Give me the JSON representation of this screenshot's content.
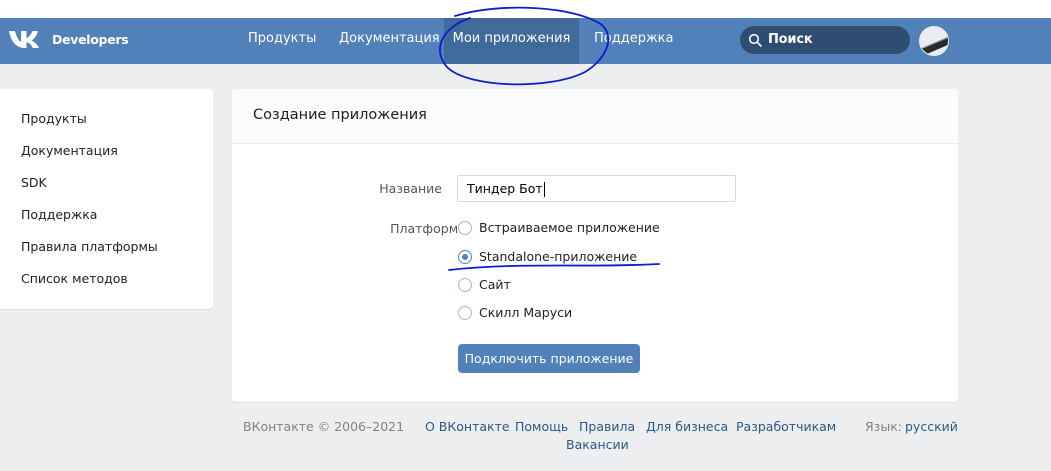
{
  "header": {
    "brand": "Developers",
    "logo_icon": "vk-logo-icon",
    "nav": [
      {
        "label": "Продукты",
        "active": false
      },
      {
        "label": "Документация",
        "active": false
      },
      {
        "label": "Мои приложения",
        "active": true
      },
      {
        "label": "Поддержка",
        "active": false
      }
    ],
    "search": {
      "label": "Поиск",
      "icon": "search-icon"
    },
    "avatar_icon": "avatar-icon"
  },
  "sidebar": {
    "items": [
      {
        "label": "Продукты"
      },
      {
        "label": "Документация"
      },
      {
        "label": "SDK"
      },
      {
        "label": "Поддержка"
      },
      {
        "label": "Правила платформы"
      },
      {
        "label": "Список методов"
      }
    ]
  },
  "form": {
    "title": "Создание приложения",
    "name_label": "Название",
    "name_value": "Тиндер Бот",
    "platform_label": "Платформа:",
    "platforms": [
      {
        "label": "Встраиваемое приложение",
        "checked": false
      },
      {
        "label": "Standalone-приложение",
        "checked": true
      },
      {
        "label": "Сайт",
        "checked": false
      },
      {
        "label": "Скилл Маруси",
        "checked": false
      }
    ],
    "submit_label": "Подключить приложение"
  },
  "footer": {
    "copyright": "ВКонтакте © 2006–2021",
    "links": [
      "О ВКонтакте",
      "Помощь",
      "Правила",
      "Для бизнеса",
      "Разработчикам",
      "Вакансии"
    ],
    "language_label": "Язык:",
    "language_value": "русский"
  },
  "colors": {
    "header_bg": "#5181b8",
    "active_nav_bg": "#3f6a99",
    "page_bg": "#edeef0",
    "link": "#2a5885",
    "annotation_ink": "#0a1dc8"
  }
}
